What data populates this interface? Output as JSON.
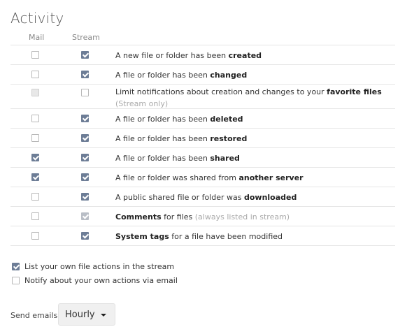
{
  "title": "Activity",
  "columns": {
    "mail": "Mail",
    "stream": "Stream"
  },
  "rows": [
    {
      "pre": "A new file or folder has been ",
      "bold": "created",
      "post": "",
      "note": "",
      "mail": false,
      "stream": true
    },
    {
      "pre": "A file or folder has been ",
      "bold": "changed",
      "post": "",
      "note": "",
      "mail": false,
      "stream": true
    },
    {
      "pre": "Limit notifications about creation and changes to your ",
      "bold": "favorite files",
      "post": "",
      "note": "(Stream only)",
      "mail": false,
      "mail_disabled": true,
      "stream": false
    },
    {
      "pre": "A file or folder has been ",
      "bold": "deleted",
      "post": "",
      "note": "",
      "mail": false,
      "stream": true
    },
    {
      "pre": "A file or folder has been ",
      "bold": "restored",
      "post": "",
      "note": "",
      "mail": false,
      "stream": true
    },
    {
      "pre": "A file or folder has been ",
      "bold": "shared",
      "post": "",
      "note": "",
      "mail": true,
      "stream": true
    },
    {
      "pre": "A file or folder was shared from ",
      "bold": "another server",
      "post": "",
      "note": "",
      "mail": true,
      "stream": true
    },
    {
      "pre": "A public shared file or folder was ",
      "bold": "downloaded",
      "post": "",
      "note": "",
      "mail": false,
      "stream": true
    },
    {
      "pre": "",
      "bold": "Comments",
      "post": " for files ",
      "note": "(always listed in stream)",
      "mail": false,
      "stream": true,
      "stream_disabled": true
    },
    {
      "pre": "",
      "bold": "System tags",
      "post": " for a file have been modified",
      "note": "",
      "mail": false,
      "stream": true
    }
  ],
  "options": {
    "own_actions_stream": {
      "label": "List your own file actions in the stream",
      "checked": true
    },
    "own_actions_email": {
      "label": "Notify about your own actions via email",
      "checked": false
    }
  },
  "send_emails": {
    "label": "Send emails:",
    "value": "Hourly"
  }
}
